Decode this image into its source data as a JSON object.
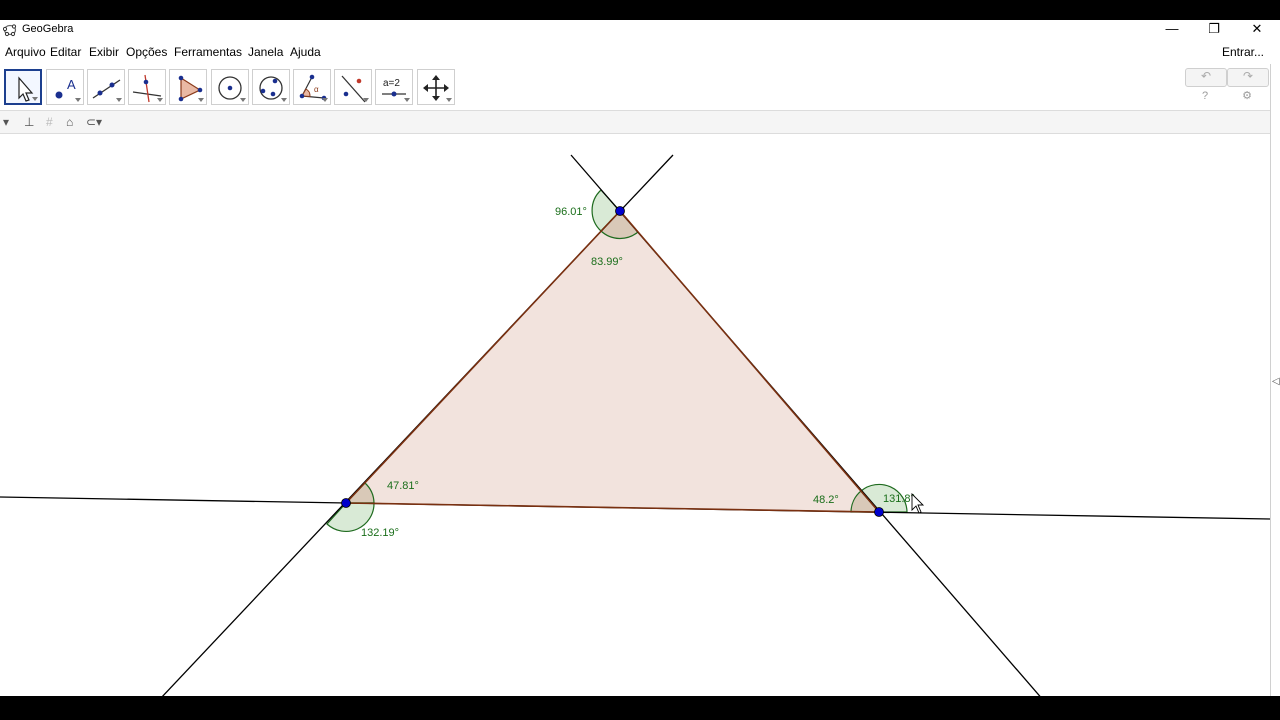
{
  "window": {
    "title": "GeoGebra",
    "minimize": "—",
    "restore": "❐",
    "close": "✕"
  },
  "menu": {
    "items": [
      {
        "label": "Arquivo"
      },
      {
        "label": "Editar"
      },
      {
        "label": "Exibir"
      },
      {
        "label": "Opções"
      },
      {
        "label": "Ferramentas"
      },
      {
        "label": "Janela"
      },
      {
        "label": "Ajuda"
      }
    ],
    "login": "Entrar..."
  },
  "toolbar": {
    "tools": [
      {
        "name": "move-tool",
        "selected": true
      },
      {
        "name": "point-tool"
      },
      {
        "name": "line-tool"
      },
      {
        "name": "perpendicular-line-tool"
      },
      {
        "name": "polygon-tool"
      },
      {
        "name": "circle-center-point-tool"
      },
      {
        "name": "circle-three-points-tool"
      },
      {
        "name": "angle-tool"
      },
      {
        "name": "reflect-tool"
      },
      {
        "name": "slider-tool",
        "text": "a=2"
      },
      {
        "name": "move-graphics-view-tool"
      }
    ],
    "undo": "↶",
    "redo": "↷",
    "help": "?",
    "settings": "⚙"
  },
  "stylebar": {
    "toggle": "▾",
    "axes": "⊥",
    "grid": "#",
    "home": "⌂",
    "view_menu": "⊂▾"
  },
  "angles": {
    "top_exterior": "96.01°",
    "top_interior": "83.99°",
    "left_interior": "47.81°",
    "left_exterior": "132.19°",
    "right_interior": "48.2°",
    "right_exterior": "131.8°"
  },
  "colors": {
    "triangle_fill": "#f2e3dd",
    "triangle_edge": "#7a3010",
    "angle_stroke": "#1f6b1f",
    "angle_fill": "#d9ead6",
    "point": "#0000cc",
    "line": "#000000"
  }
}
